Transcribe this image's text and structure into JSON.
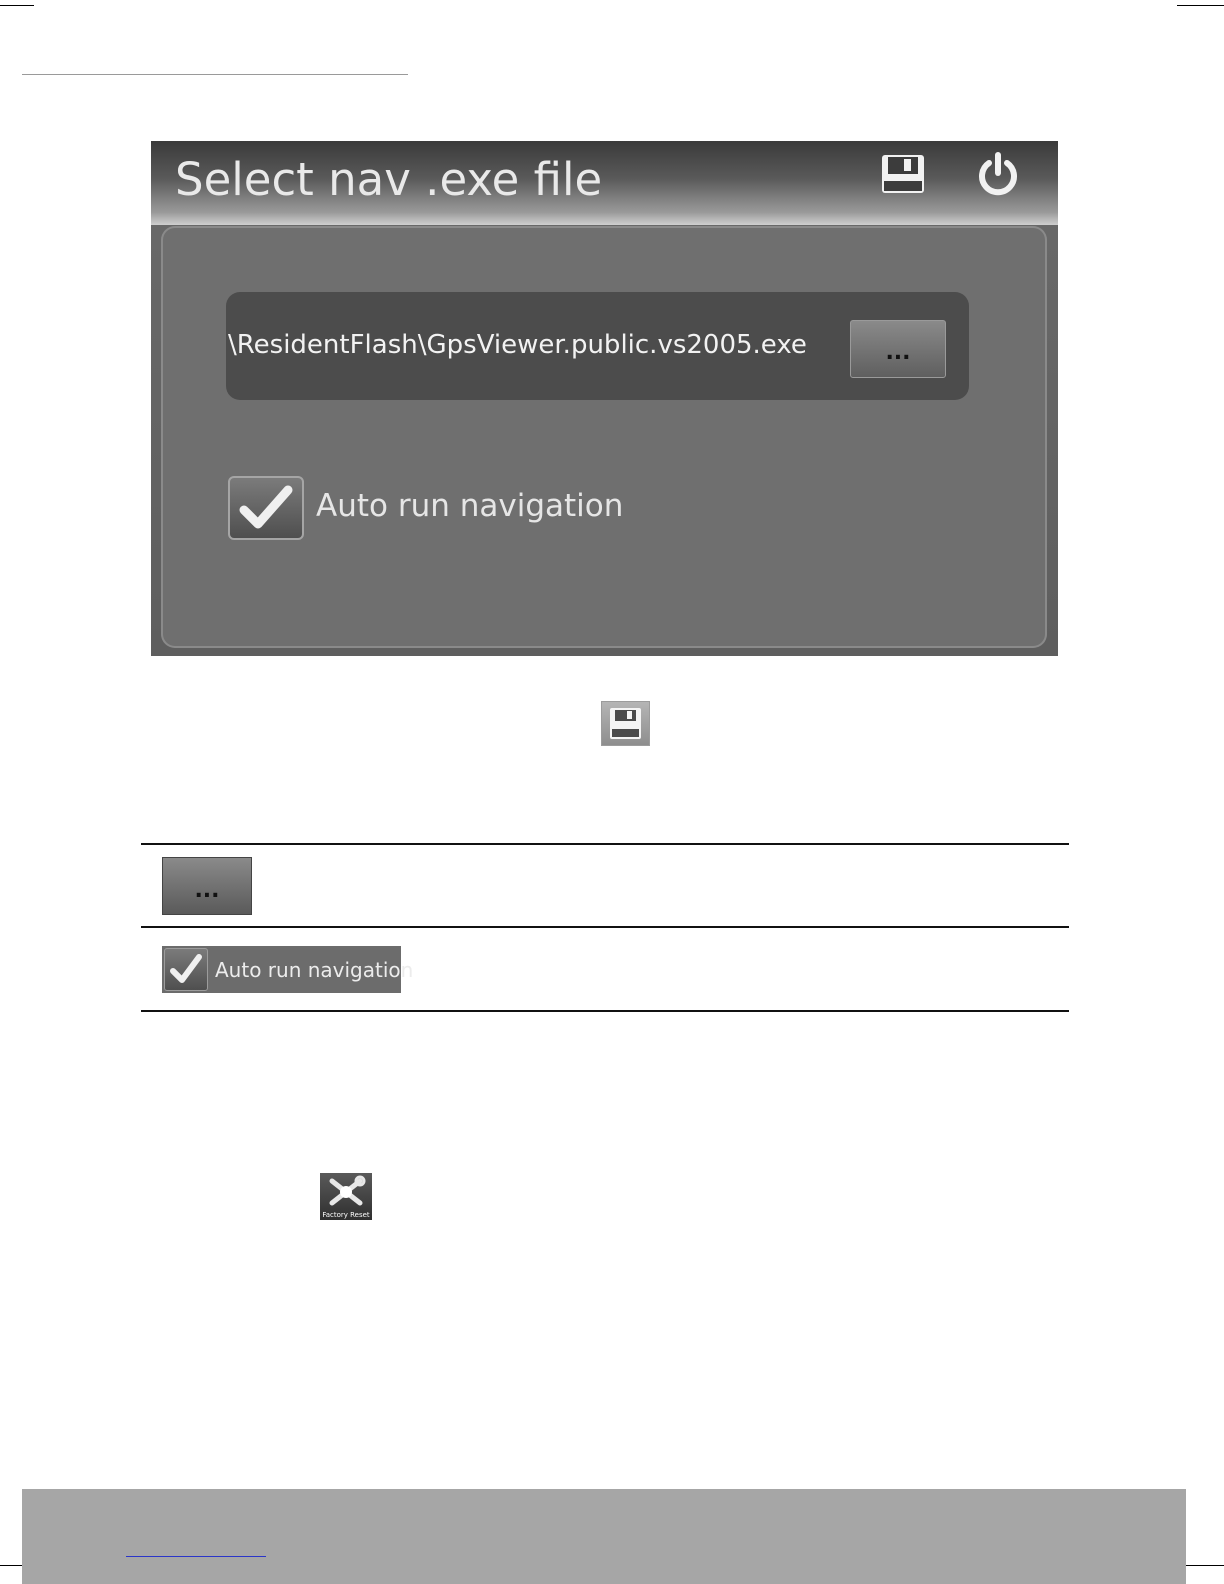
{
  "dialog": {
    "title": "Select nav .exe file",
    "path_value": "\\ResidentFlash\\GpsViewer.public.vs2005.exe",
    "browse_label": "...",
    "auto_run_label": "Auto run navigation",
    "auto_run_checked": true,
    "icons": [
      "save-icon",
      "power-icon"
    ]
  },
  "legend_table": {
    "rows": [
      {
        "icon": "browse-button",
        "label": "..."
      },
      {
        "icon": "checkbox-checked",
        "label": "Auto run navigation"
      }
    ]
  },
  "factory_reset": {
    "label": "Factory Reset"
  }
}
